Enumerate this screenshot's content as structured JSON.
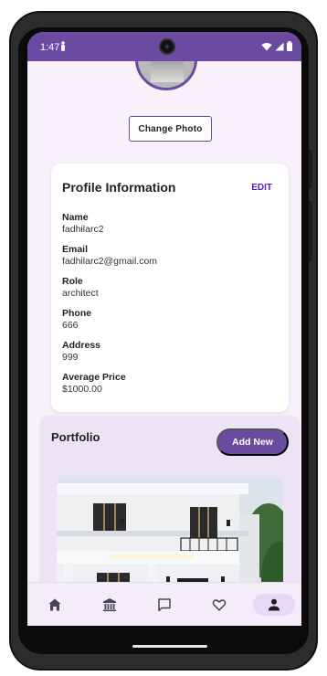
{
  "status_bar": {
    "time": "1:47"
  },
  "profile": {
    "change_photo_label": "Change Photo"
  },
  "profile_info": {
    "title": "Profile Information",
    "edit_label": "EDIT",
    "fields": [
      {
        "label": "Name",
        "value": "fadhilarc2"
      },
      {
        "label": "Email",
        "value": "fadhilarc2@gmail.com"
      },
      {
        "label": "Role",
        "value": "architect"
      },
      {
        "label": "Phone",
        "value": "666"
      },
      {
        "label": "Address",
        "value": "999"
      },
      {
        "label": "Average Price",
        "value": "$1000.00"
      }
    ]
  },
  "portfolio": {
    "title": "Portfolio",
    "add_new_label": "Add New"
  },
  "bottom_nav": {
    "items": [
      {
        "icon": "home-icon"
      },
      {
        "icon": "bank-icon"
      },
      {
        "icon": "chat-icon"
      },
      {
        "icon": "heart-icon"
      },
      {
        "icon": "person-icon",
        "active": true
      }
    ]
  },
  "colors": {
    "primary": "#6a4ba1",
    "accent_text": "#5b1cc7",
    "background": "#f8f1fc",
    "portfolio_bg": "#ece3f4",
    "nav_active": "#e6d8f7"
  }
}
